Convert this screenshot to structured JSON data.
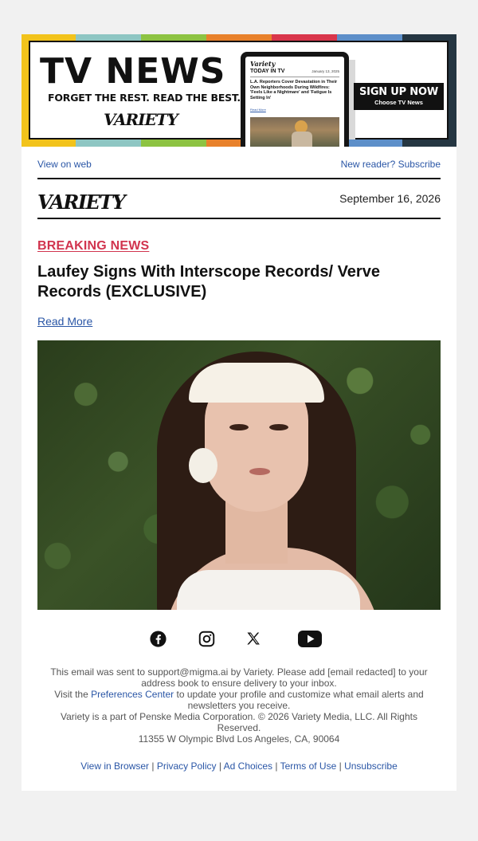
{
  "banner": {
    "title": "TV NEWS",
    "tagline": "FORGET THE REST. READ THE BEST.",
    "logo": "VARIETY",
    "tablet": {
      "logo": "Variety",
      "section": "TODAY IN TV",
      "date": "January 13, 2025",
      "headline": "L.A. Reporters Cover Devastation in Their Own Neighborhoods During Wildfires: 'Feels Like a Nightmare' and 'Fatigue Is Setting In'",
      "read_more": "Read More"
    },
    "signup_label": "SIGN UP NOW",
    "signup_sub": "Choose TV News",
    "stripe_colors": [
      "#f2c31b",
      "#8ec6c3",
      "#8dc342",
      "#e8812b",
      "#d9364b",
      "#5d8fc9",
      "#253642"
    ]
  },
  "links": {
    "view_on_web": "View on web",
    "subscribe": "New reader? Subscribe"
  },
  "masthead": {
    "logo": "VARIETY",
    "date": "September 16, 2026"
  },
  "article": {
    "kicker": "BREAKING NEWS",
    "headline": "Laufey Signs With Interscope Records/ Verve Records (EXCLUSIVE)",
    "read_more": "Read More"
  },
  "social": {
    "icons": [
      "facebook-icon",
      "instagram-icon",
      "x-icon",
      "youtube-icon"
    ]
  },
  "footer": {
    "line1": "This email was sent to support@migma.ai by Variety. Please add [email redacted] to your address book to ensure delivery to your inbox.",
    "visit_prefix": "Visit the ",
    "preferences_link": "Preferences Center",
    "visit_suffix": " to update your profile and customize what email alerts and newsletters you receive.",
    "copyright": "Variety is a part of Penske Media Corporation. © 2026 Variety Media, LLC. All Rights Reserved.",
    "address": "11355 W Olympic Blvd Los Angeles, CA, 90064",
    "links": [
      "View in Browser",
      "Privacy Policy",
      "Ad Choices",
      "Terms of Use",
      "Unsubscribe"
    ],
    "separator": " | "
  },
  "colors": {
    "accent": "#d1344e",
    "link": "#2a56a6",
    "background": "#f1f1f1"
  }
}
